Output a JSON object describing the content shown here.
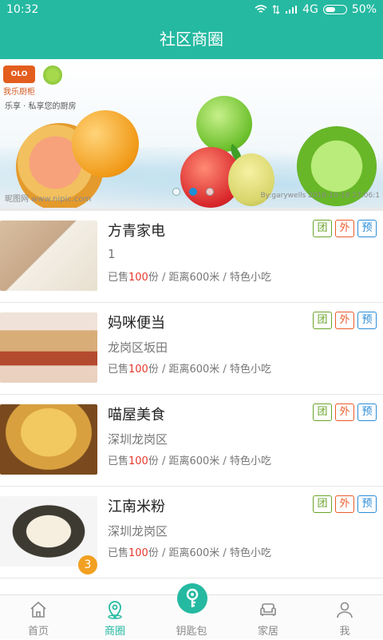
{
  "status_bar": {
    "time": "10:32",
    "network": "4G",
    "battery": "50%"
  },
  "header": {
    "title": "社区商圈"
  },
  "banner": {
    "logo_brand": "OLO",
    "logo_text": "我乐厨柜",
    "slogan": "乐享 · 私享您的厨房",
    "watermark": "昵图网 www.nipic.com",
    "watermark_right": "By:garywells 2016-10-18 17:06:1",
    "active_slide": 2,
    "slide_count": 3
  },
  "stores": [
    {
      "name": "方青家电",
      "address": "1",
      "sold_prefix": "已售",
      "sold_count": "100",
      "sold_suffix": "份 / 距离600米 / 特色小吃",
      "tags": [
        "团",
        "外",
        "预"
      ]
    },
    {
      "name": "妈咪便当",
      "address": "龙岗区坂田",
      "sold_prefix": "已售",
      "sold_count": "100",
      "sold_suffix": "份 / 距离600米 / 特色小吃",
      "tags": [
        "团",
        "外",
        "预"
      ]
    },
    {
      "name": "喵屋美食",
      "address": "深圳龙岗区",
      "sold_prefix": "已售",
      "sold_count": "100",
      "sold_suffix": "份 / 距离600米 / 特色小吃",
      "tags": [
        "团",
        "外",
        "预"
      ]
    },
    {
      "name": "江南米粉",
      "address": "深圳龙岗区",
      "sold_prefix": "已售",
      "sold_count": "100",
      "sold_suffix": "份 / 距离600米 / 特色小吃",
      "tags": [
        "团",
        "外",
        "预"
      ],
      "badge": "3"
    }
  ],
  "tabbar": {
    "items": [
      {
        "label": "首页",
        "icon": "home-icon"
      },
      {
        "label": "商圈",
        "icon": "location-icon",
        "active": true
      },
      {
        "label": "钥匙包",
        "icon": "key-icon"
      },
      {
        "label": "家居",
        "icon": "sofa-icon"
      },
      {
        "label": "我",
        "icon": "person-icon"
      }
    ]
  },
  "colors": {
    "primary": "#25b9a1",
    "tag_group": "#6aa428",
    "tag_delivery": "#ea5b29",
    "tag_reserve": "#2a8cd8",
    "highlight": "#e5382c"
  }
}
